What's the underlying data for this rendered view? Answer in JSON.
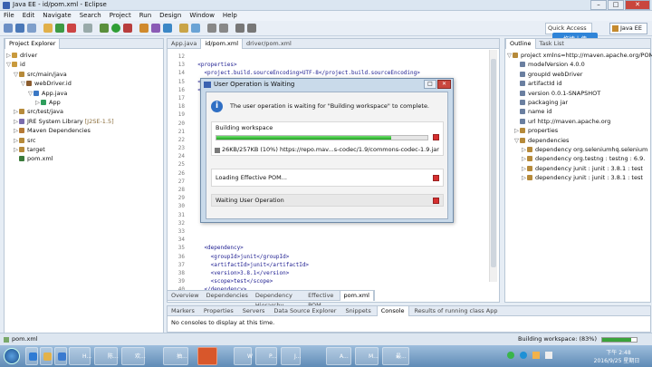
{
  "window": {
    "title": "Java EE - id/pom.xml - Eclipse"
  },
  "menu": [
    "File",
    "Edit",
    "Navigate",
    "Search",
    "Project",
    "Run",
    "Design",
    "Window",
    "Help"
  ],
  "toolbar": {
    "quick_access": "Quick Access",
    "perspective": "Java EE",
    "upload_label": "拖拽上传"
  },
  "explorer": {
    "tab": "Project Explorer",
    "items": [
      {
        "label": "driver",
        "arrow": "▷",
        "depth": 0
      },
      {
        "label": "id",
        "arrow": "▽",
        "depth": 0
      },
      {
        "label": "src/main/java",
        "arrow": "▽",
        "depth": 1
      },
      {
        "label": "webDriver.id",
        "arrow": "▽",
        "depth": 2
      },
      {
        "label": "App.java",
        "arrow": "▽",
        "depth": 3
      },
      {
        "label": "App",
        "arrow": "▷",
        "depth": 4
      },
      {
        "label": "src/test/java",
        "arrow": "▷",
        "depth": 1
      },
      {
        "label": "JRE System Library",
        "suffix": "[J2SE-1.5]",
        "arrow": "▷",
        "depth": 1
      },
      {
        "label": "Maven Dependencies",
        "arrow": "▷",
        "depth": 1
      },
      {
        "label": "src",
        "arrow": "▷",
        "depth": 1
      },
      {
        "label": "target",
        "arrow": "▷",
        "depth": 1
      },
      {
        "label": "pom.xml",
        "arrow": "",
        "depth": 1
      }
    ]
  },
  "editor": {
    "tabs": [
      "App.java",
      "id/pom.xml",
      "driver/pom.xml"
    ],
    "lines": [
      {
        "n": "12",
        "t": ""
      },
      {
        "n": "13",
        "t": "  <properties>"
      },
      {
        "n": "14",
        "t": "    <project.build.sourceEncoding>UTF-8</project.build.sourceEncoding>"
      },
      {
        "n": "15",
        "t": "  </properties>"
      },
      {
        "n": "16",
        "t": "  <d"
      },
      {
        "n": "17",
        "t": ""
      },
      {
        "n": "18",
        "t": ""
      },
      {
        "n": "19",
        "t": ""
      },
      {
        "n": "20",
        "t": ""
      },
      {
        "n": "21",
        "t": ""
      },
      {
        "n": "22",
        "t": ""
      },
      {
        "n": "23",
        "t": ""
      },
      {
        "n": "24",
        "t": ""
      },
      {
        "n": "25",
        "t": ""
      },
      {
        "n": "26",
        "t": ""
      },
      {
        "n": "27",
        "t": ""
      },
      {
        "n": "28",
        "t": ""
      },
      {
        "n": "29",
        "t": ""
      },
      {
        "n": "30",
        "t": ""
      },
      {
        "n": "31",
        "t": ""
      },
      {
        "n": "32",
        "t": ""
      },
      {
        "n": "33",
        "t": ""
      },
      {
        "n": "34",
        "t": ""
      },
      {
        "n": "35",
        "t": "    <dependency>"
      },
      {
        "n": "36",
        "t": "      <groupId>junit</groupId>"
      },
      {
        "n": "37",
        "t": "      <artifactId>junit</artifactId>"
      },
      {
        "n": "38",
        "t": "      <version>3.8.1</version>"
      },
      {
        "n": "39",
        "t": "      <scope>test</scope>"
      },
      {
        "n": "40",
        "t": "    </dependency>"
      },
      {
        "n": "41",
        "t": "  </dependencies>"
      },
      {
        "n": "42",
        "t": "</project>"
      },
      {
        "n": "43",
        "t": ""
      }
    ],
    "bottom_tabs": [
      "Overview",
      "Dependencies",
      "Dependency Hierarchy",
      "Effective POM",
      "pom.xml"
    ]
  },
  "outline": {
    "tabs": [
      "Outline",
      "Task List"
    ],
    "items": [
      {
        "label": "project xmlns=http://maven.apache.org/POM",
        "depth": 0,
        "arrow": "▽"
      },
      {
        "label": "modelVersion  4.0.0",
        "depth": 1,
        "arrow": ""
      },
      {
        "label": "groupId  webDriver",
        "depth": 1,
        "arrow": ""
      },
      {
        "label": "artifactId  id",
        "depth": 1,
        "arrow": ""
      },
      {
        "label": "version  0.0.1-SNAPSHOT",
        "depth": 1,
        "arrow": ""
      },
      {
        "label": "packaging  jar",
        "depth": 1,
        "arrow": ""
      },
      {
        "label": "name  id",
        "depth": 1,
        "arrow": ""
      },
      {
        "label": "url  http://maven.apache.org",
        "depth": 1,
        "arrow": ""
      },
      {
        "label": "properties",
        "depth": 1,
        "arrow": "▷"
      },
      {
        "label": "dependencies",
        "depth": 1,
        "arrow": "▽"
      },
      {
        "label": "dependency  org.seleniumhq.selenium",
        "depth": 2,
        "arrow": "▷"
      },
      {
        "label": "dependency  org.testng : testng : 6.9.",
        "depth": 2,
        "arrow": "▷"
      },
      {
        "label": "dependency  junit : junit : 3.8.1 : test",
        "depth": 2,
        "arrow": "▷"
      },
      {
        "label": "dependency  junit : junit : 3.8.1 : test",
        "depth": 2,
        "arrow": "▷"
      }
    ]
  },
  "console": {
    "tabs": [
      "Markers",
      "Properties",
      "Servers",
      "Data Source Explorer",
      "Snippets",
      "Console",
      "Results of running class App"
    ],
    "message": "No consoles to display at this time."
  },
  "status": {
    "file": "pom.xml",
    "building": "Building workspace: (83%)"
  },
  "dialog": {
    "title": "User Operation is Waiting",
    "message": "The user operation is waiting for \"Building workspace\" to complete.",
    "jobs": [
      {
        "name": "Building workspace",
        "detail": "26KB/257KB (10%) https://repo.mav...s-codec/1.9/commons-codec-1.9.jar",
        "progress": 0.83
      },
      {
        "name": "Loading Effective POM..."
      },
      {
        "name": "Waiting User Operation"
      }
    ]
  },
  "taskbar": {
    "items": [
      "H...",
      "陈...",
      "欢...",
      "抽...",
      "W",
      "P...",
      "J...",
      "A...",
      "M...",
      "最..."
    ],
    "clock_time": "下午 2:48",
    "clock_date": "2016/9/25 星期日"
  }
}
